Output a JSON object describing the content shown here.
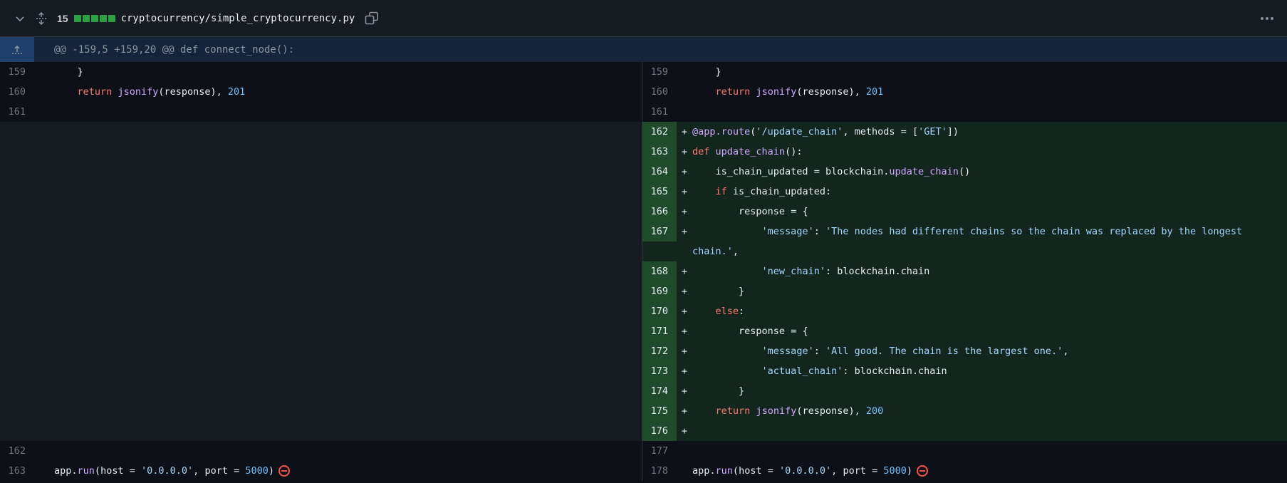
{
  "header": {
    "changes_count": "15",
    "file_path": "cryptocurrency/simple_cryptocurrency.py",
    "icons": {
      "collapse": "chevron-down-icon",
      "expand_all": "expand-arrows-icon",
      "copy": "copy-icon",
      "more": "kebab-horizontal-icon"
    }
  },
  "hunk": {
    "header_text": "@@ -159,5 +159,20 @@ def connect_node():"
  },
  "colors": {
    "addition_bg": "#12261e",
    "addition_gutter": "#1f4a2c",
    "hunk_bg": "#15233b",
    "keyword": "#ff7b72",
    "function": "#d2a8ff",
    "number": "#79c0ff",
    "string": "#a5d6ff"
  },
  "left_lines": [
    {
      "num": "159",
      "code": "    }"
    },
    {
      "num": "160",
      "code": "    return jsonify(response), 201"
    },
    {
      "num": "161",
      "code": ""
    }
  ],
  "left_tail": [
    {
      "num": "162",
      "code": ""
    },
    {
      "num": "163",
      "code": "app.run(host = '0.0.0.0', port = 5000)"
    }
  ],
  "right_lines": [
    {
      "num": "159",
      "code": "    }"
    },
    {
      "num": "160",
      "code": "    return jsonify(response), 201"
    },
    {
      "num": "161",
      "code": ""
    }
  ],
  "right_added": [
    {
      "num": "162",
      "code": "@app.route('/update_chain', methods = ['GET'])"
    },
    {
      "num": "163",
      "code": "def update_chain():"
    },
    {
      "num": "164",
      "code": "    is_chain_updated = blockchain.update_chain()"
    },
    {
      "num": "165",
      "code": "    if is_chain_updated:"
    },
    {
      "num": "166",
      "code": "        response = {"
    },
    {
      "num": "167",
      "code": "            'message': 'The nodes had different chains so the chain was replaced by the longest chain.',"
    },
    {
      "num": "168",
      "code": "            'new_chain': blockchain.chain"
    },
    {
      "num": "169",
      "code": "        }"
    },
    {
      "num": "170",
      "code": "    else:"
    },
    {
      "num": "171",
      "code": "        response = {"
    },
    {
      "num": "172",
      "code": "            'message': 'All good. The chain is the largest one.',"
    },
    {
      "num": "173",
      "code": "            'actual_chain': blockchain.chain"
    },
    {
      "num": "174",
      "code": "        }"
    },
    {
      "num": "175",
      "code": "    return jsonify(response), 200"
    },
    {
      "num": "176",
      "code": ""
    }
  ],
  "right_tail": [
    {
      "num": "177",
      "code": ""
    },
    {
      "num": "178",
      "code": "app.run(host = '0.0.0.0', port = 5000)"
    }
  ],
  "added_sign": "+",
  "no_newline_icon": "no-entry-icon"
}
